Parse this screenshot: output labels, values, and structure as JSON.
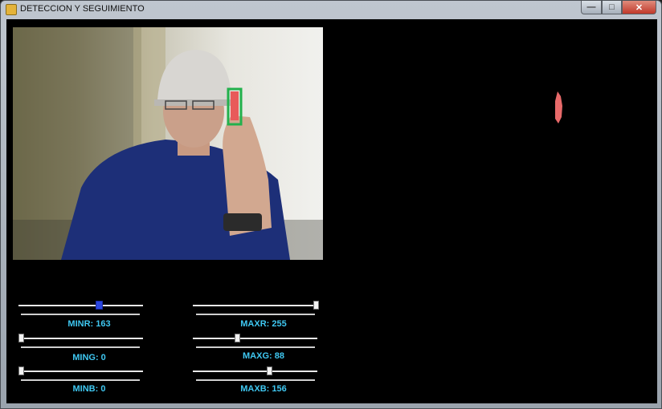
{
  "window": {
    "title": "DETECCION Y SEGUIMIENTO",
    "controls": {
      "minimize": "—",
      "maximize": "□",
      "close": "✕"
    }
  },
  "sliders": [
    {
      "label": "MINR: 163",
      "value": 163,
      "max": 255,
      "active": true
    },
    {
      "label": "MING: 0",
      "value": 0,
      "max": 255,
      "active": false
    },
    {
      "label": "MINB: 0",
      "value": 0,
      "max": 255,
      "active": false
    },
    {
      "label": "MAXR: 255",
      "value": 255,
      "max": 255,
      "active": false
    },
    {
      "label": "MAXG: 88",
      "value": 88,
      "max": 255,
      "active": false
    },
    {
      "label": "MAXB: 156",
      "value": 156,
      "max": 255,
      "active": false
    }
  ],
  "colors": {
    "label": "#3fc8f2",
    "tracking_box": "#22b14c",
    "detected_object": "#e85a5a",
    "slider_active_thumb": "#2a46e0"
  }
}
